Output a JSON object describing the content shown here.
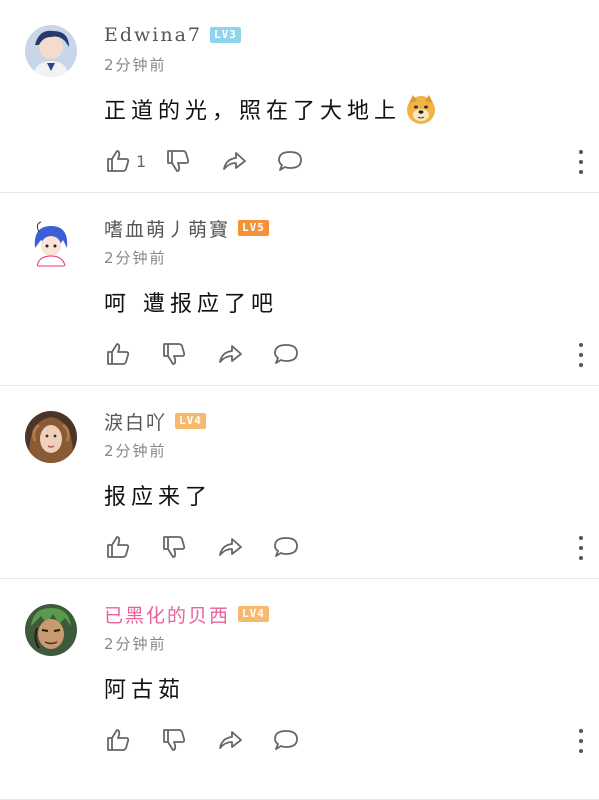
{
  "comments": [
    {
      "username": "Edwina7",
      "level": "LV3",
      "time": "2分钟前",
      "text": "正道的光，照在了大地上",
      "emoji": "doge-emoji",
      "likes": "1",
      "username_color": "#555555"
    },
    {
      "username": "嗜血萌丿萌寶",
      "level": "LV5",
      "time": "2分钟前",
      "text": "呵 遭报应了吧",
      "likes": "",
      "username_color": "#555555"
    },
    {
      "username": "淚白吖",
      "level": "LV4",
      "time": "2分钟前",
      "text": "报应来了",
      "likes": "",
      "username_color": "#555555"
    },
    {
      "username": "已黑化的贝西",
      "level": "LV4",
      "time": "2分钟前",
      "text": "阿古茹",
      "likes": "",
      "username_color": "#e8629a"
    }
  ],
  "icons": {
    "like": "thumbs-up-icon",
    "dislike": "thumbs-down-icon",
    "share": "share-icon",
    "reply": "comment-icon",
    "more": "more-vertical-icon"
  },
  "colors": {
    "lv3": "#8fd3ee",
    "lv5": "#f39237",
    "lv4": "#f6b96d",
    "divider": "#e6e6e6"
  }
}
